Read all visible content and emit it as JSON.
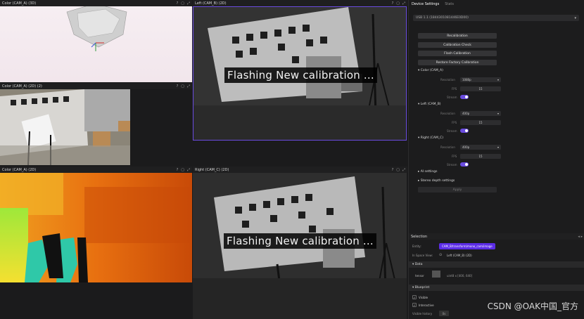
{
  "views": {
    "v1_title": "Color (CAM_A) (3D)",
    "v2_title": "Left (CAM_B) (2D)",
    "v3_title": "Color (CAM_A) (2D) (2)",
    "v4_title": "Color (CAM_A) (2D)",
    "v5_title": "Right (CAM_C) (2D)",
    "overlay_text": "Flashing New calibration ...",
    "help_icon": "?"
  },
  "side": {
    "tab_device": "Device Settings",
    "tab_stats": "Stats",
    "device_value": "USB 1.1 (1844301081446E0D00)",
    "buttons": {
      "recalibration": "Recalibration",
      "calibration_check": "Calibration Check",
      "flash_calibration": "Flash Calibration",
      "restore": "Restore Factory Calibration"
    },
    "color_section": "Color (CAM_A)",
    "left_section": "Left (CAM_B)",
    "right_section": "Right (CAM_C)",
    "resolution_label": "Resolution",
    "fps_label": "FPS",
    "stream_label": "Stream",
    "color_resolution": "1080p",
    "color_fps": "15",
    "left_resolution": "400p",
    "left_fps": "15",
    "right_resolution": "400p",
    "right_fps": "15",
    "ai_settings": "AI settings",
    "stereo_settings": "Stereo depth settings",
    "apply": "Apply"
  },
  "selection": {
    "header": "Selection",
    "entity_label": "Entity:",
    "entity_value": "CAM_B/transform/mono_cam/image",
    "space_label": "In Space View:",
    "space_value": "Left (CAM_B) (2D)",
    "data_header": "Data",
    "tensor_label": "tensor",
    "tensor_value": "uint8 x [400, 640]",
    "blueprint_header": "Blueprint",
    "visible_label": "Visible",
    "interactive_label": "Interactive",
    "history_label": "Visible history",
    "history_value": "0s"
  },
  "watermark": "CSDN @OAK中国_官方",
  "colors": {
    "accent": "#6a4ce0",
    "entity_chip": "#5b2ce6"
  }
}
